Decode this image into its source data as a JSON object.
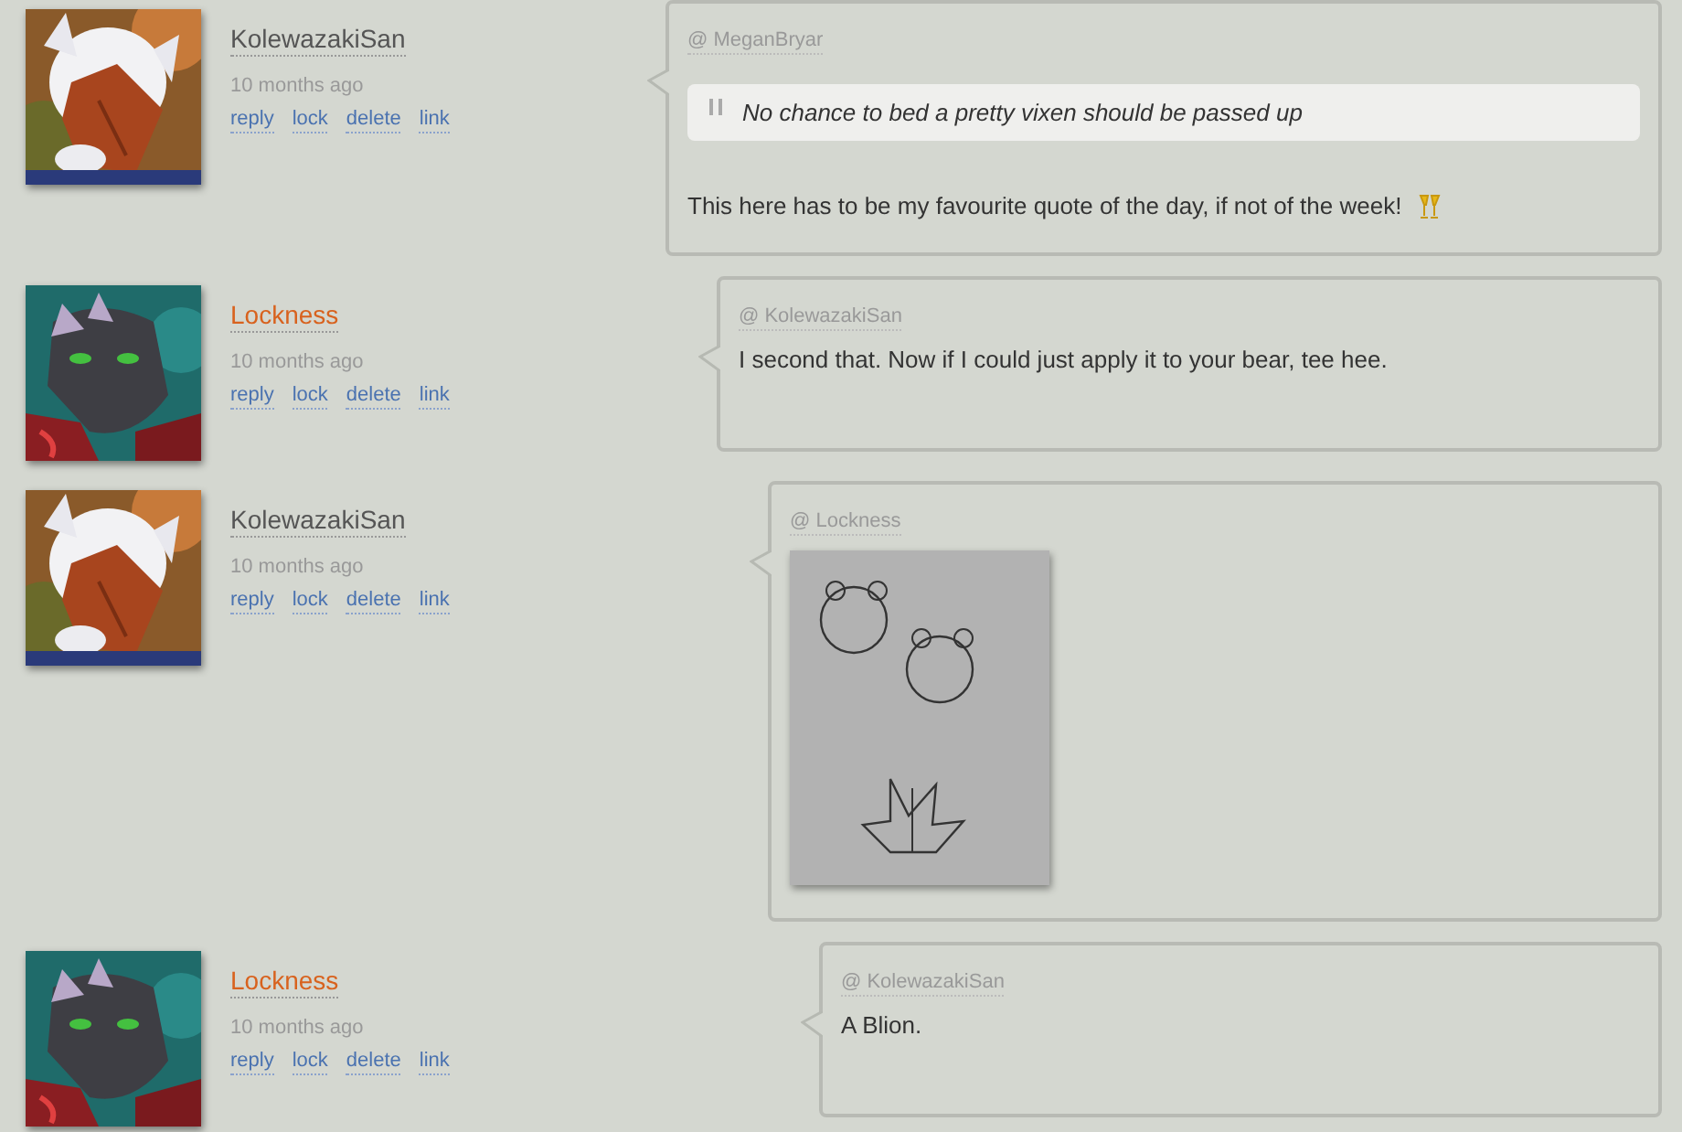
{
  "comments": [
    {
      "author": "KolewazakiSan",
      "author_highlighted": false,
      "time": "10 months ago",
      "actions": [
        "reply",
        "lock",
        "delete",
        "link"
      ],
      "reply_to": "@ MeganBryar",
      "body": [
        {
          "kind": "quote",
          "text": "No chance to bed a pretty vixen should be passed up"
        },
        {
          "kind": "text",
          "text": "This here has to be my favourite quote of the day, if not of the week!",
          "emoji": true
        }
      ],
      "children": [
        {
          "author": "Lockness",
          "author_highlighted": true,
          "time": "10 months ago",
          "actions": [
            "reply",
            "lock",
            "delete",
            "link"
          ],
          "reply_to": "@ KolewazakiSan",
          "body": [
            {
              "kind": "text",
              "text": "I second that. Now if I could just apply it to your bear, tee hee."
            }
          ],
          "children": [
            {
              "author": "KolewazakiSan",
              "author_highlighted": false,
              "time": "10 months ago",
              "actions": [
                "reply",
                "lock",
                "delete",
                "link"
              ],
              "reply_to": "@ Lockness",
              "body": [
                {
                  "kind": "picture"
                }
              ],
              "children": [
                {
                  "author": "Lockness",
                  "author_highlighted": true,
                  "time": "10 months ago",
                  "actions": [
                    "reply",
                    "lock",
                    "delete",
                    "link"
                  ],
                  "reply_to": "@ KolewazakiSan",
                  "body": [
                    {
                      "kind": "text",
                      "text": "A Blion."
                    }
                  ]
                }
              ]
            }
          ]
        }
      ]
    }
  ]
}
